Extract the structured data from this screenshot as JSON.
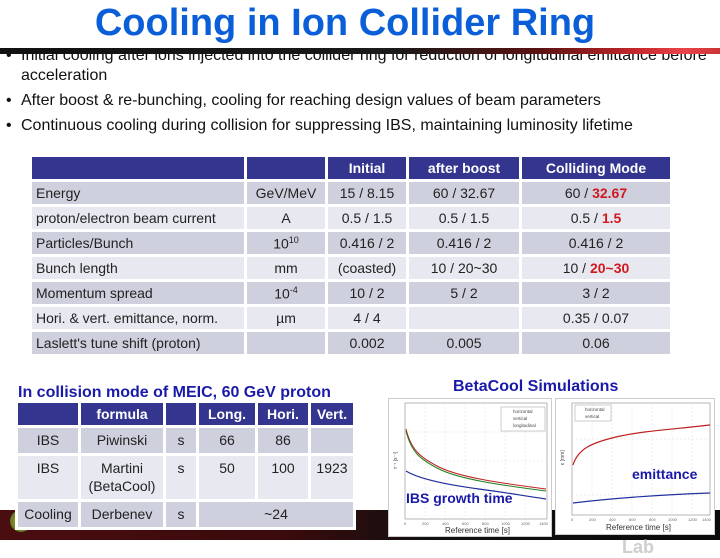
{
  "title": "Cooling in Ion Collider Ring",
  "bullets": [
    "Initial cooling after ions injected into the collider ring for reduction of longitudinal emittance before acceleration",
    "After boost & re-bunching, cooling for reaching design values of beam parameters",
    "Continuous cooling during collision for suppressing IBS, maintaining luminosity lifetime"
  ],
  "bullet_marker": "•",
  "params_table": {
    "headers": [
      "",
      "",
      "Initial",
      "after boost",
      "Colliding Mode"
    ],
    "rows": [
      {
        "label": "Energy",
        "unit": "GeV/MeV",
        "initial": "15 / 8.15",
        "after_boost": "60 / 32.67",
        "colliding_prefix": "60 / ",
        "colliding_highlight": "32.67"
      },
      {
        "label": "proton/electron beam current",
        "unit": "A",
        "initial": "0.5 / 1.5",
        "after_boost": "0.5 / 1.5",
        "colliding_prefix": "0.5 / ",
        "colliding_highlight": "1.5"
      },
      {
        "label": "Particles/Bunch",
        "unit_base": "10",
        "unit_exp": "10",
        "initial": "0.416 / 2",
        "after_boost": "0.416 / 2",
        "colliding_prefix": "0.416 / 2",
        "colliding_highlight": ""
      },
      {
        "label": "Bunch length",
        "unit": "mm",
        "initial": "(coasted)",
        "after_boost": "10 / 20~30",
        "colliding_prefix": "10 / ",
        "colliding_highlight": "20~30"
      },
      {
        "label": "Momentum spread",
        "unit_base": "10",
        "unit_exp": "-4",
        "initial": "10 / 2",
        "after_boost": "5 / 2",
        "colliding_prefix": "3 / 2",
        "colliding_highlight": ""
      },
      {
        "label": "Hori. & vert. emittance, norm.",
        "unit": "µm",
        "initial": "4 / 4",
        "after_boost": "",
        "colliding_prefix": "0.35 / 0.07",
        "colliding_highlight": ""
      },
      {
        "label": "Laslett's tune shift (proton)",
        "unit": "",
        "initial": "0.002",
        "after_boost": "0.005",
        "colliding_prefix": "0.06",
        "colliding_highlight": ""
      }
    ]
  },
  "collision_section": {
    "title": "In collision mode of MEIC, 60 GeV proton",
    "headers": [
      "",
      "formula",
      "",
      "Long.",
      "Hori.",
      "Vert."
    ],
    "rows": [
      {
        "type": "IBS",
        "formula": "Piwinski",
        "formula2": "",
        "unit": "s",
        "long": "66",
        "hori": "86",
        "vert": ""
      },
      {
        "type": "IBS",
        "formula": "Martini",
        "formula2": "(BetaCool)",
        "unit": "s",
        "long": "50",
        "hori": "100",
        "vert": "1923"
      },
      {
        "type": "Cooling",
        "formula": "Derbenev",
        "formula2": "",
        "unit": "s",
        "combined": "~24"
      }
    ]
  },
  "simulations": {
    "title": "BetaCool Simulations",
    "ibs_plot": {
      "overlay": "IBS growth time",
      "xlabel": "Reference time [s]",
      "ylabel": "τ⁻¹ [s⁻¹]",
      "legend": [
        "horizontal",
        "vertical",
        "longitudinal"
      ],
      "xticks": [
        "0",
        "200",
        "400",
        "600",
        "800",
        "1000",
        "1200",
        "1400"
      ]
    },
    "emittance_plot": {
      "overlay": "emittance",
      "xlabel": "Reference time [s]",
      "ylabel": "ε [mm]",
      "legend": [
        "horizontal",
        "vertical"
      ],
      "xticks": [
        "0",
        "200",
        "400",
        "600",
        "800",
        "1000",
        "1200",
        "1400"
      ]
    }
  },
  "footer": {
    "lab_name": "Jefferson Lab"
  },
  "colors": {
    "title": "#0a5fd8",
    "table_header": "#33358f",
    "row_odd": "#ced0de",
    "row_even": "#e8e9f0",
    "highlight": "#d0191f",
    "section_title": "#1a1aa8"
  }
}
